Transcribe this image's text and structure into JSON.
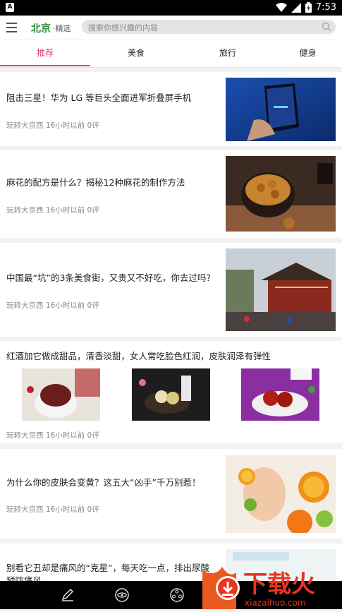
{
  "status_bar": {
    "time": "7:53"
  },
  "header": {
    "city": "北京",
    "city_suffix": "·精选",
    "search_placeholder": "搜索你感兴趣的内容"
  },
  "tabs": [
    {
      "label": "推荐"
    },
    {
      "label": "美食"
    },
    {
      "label": "旅行"
    },
    {
      "label": "健身"
    }
  ],
  "articles": [
    {
      "title": "阻击三星！华为 LG 等巨头全面进军折叠屏手机",
      "meta": "玩转大京西 16小时以前 0评"
    },
    {
      "title": "麻花的配方是什么？揭秘12种麻花的制作方法",
      "meta": "玩转大京西 16小时以前 0评"
    },
    {
      "title": "中国最“坑”的3条美食街，又贵又不好吃，你去过吗？",
      "meta": "玩转大京西 16小时以前 0评"
    },
    {
      "title": "红酒加它做成甜品，清香淡甜，女人常吃脸色红润，皮肤润泽有弹性",
      "meta": "玩转大京西 16小时以前 0评"
    },
    {
      "title": "为什么你的皮肤会变黄？这五大“凶手”千万别惹！",
      "meta": "玩转大京西 16小时以前 0评"
    },
    {
      "title_line1": "别看它丑却是痛风的“克星”，每天吃一点，排出尿酸",
      "title_line2": "预防痛风"
    }
  ],
  "watermark": {
    "brand": "下载火",
    "url": "xiazaihuo.com"
  },
  "colors": {
    "accent": "#e8447a",
    "city": "#2e8b3a"
  }
}
